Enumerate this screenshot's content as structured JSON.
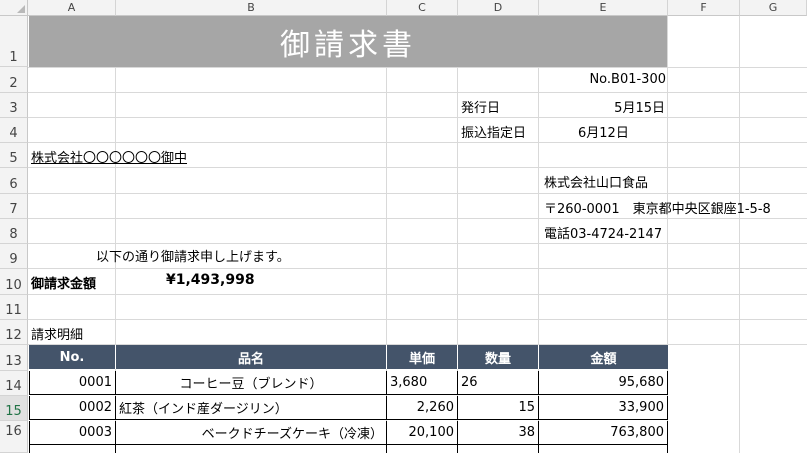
{
  "columns": [
    "A",
    "B",
    "C",
    "D",
    "E",
    "F",
    "G"
  ],
  "rows": [
    "1",
    "2",
    "3",
    "4",
    "5",
    "6",
    "7",
    "8",
    "9",
    "10",
    "11",
    "12",
    "13",
    "14",
    "15",
    "16"
  ],
  "selected_row": "15",
  "invoice": {
    "title": "御請求書",
    "number": "No.B01-300",
    "issue_label": "発行日",
    "issue_date": "5月15日",
    "transfer_label": "振込指定日",
    "transfer_date": "6月12日",
    "recipient": "株式会社〇〇〇〇〇〇御中",
    "sender_name": "株式会社山口食品",
    "sender_address": "〒260-0001　東京都中央区銀座1-5-8",
    "sender_phone": "電話03-4724-2147",
    "message": "以下の通り御請求申し上げます。",
    "amount_label": "御請求金額",
    "amount_value": "¥1,493,998",
    "details_label": "請求明細"
  },
  "table": {
    "headers": [
      "No.",
      "品名",
      "単価",
      "数量",
      "金額"
    ],
    "rows": [
      {
        "no": "0001",
        "name": "コーヒー豆（ブレンド）",
        "price": "3,680",
        "qty": "26",
        "amount": "95,680"
      },
      {
        "no": "0002",
        "name": "紅茶（インド産ダージリン）",
        "price": "2,260",
        "qty": "15",
        "amount": "33,900"
      },
      {
        "no": "0003",
        "name": "ベークドチーズケーキ（冷凍）",
        "price": "20,100",
        "qty": "38",
        "amount": "763,800"
      }
    ]
  },
  "colors": {
    "title_bg": "#a6a6a6",
    "header_bg": "#44546a",
    "selected_row": "#217346"
  }
}
